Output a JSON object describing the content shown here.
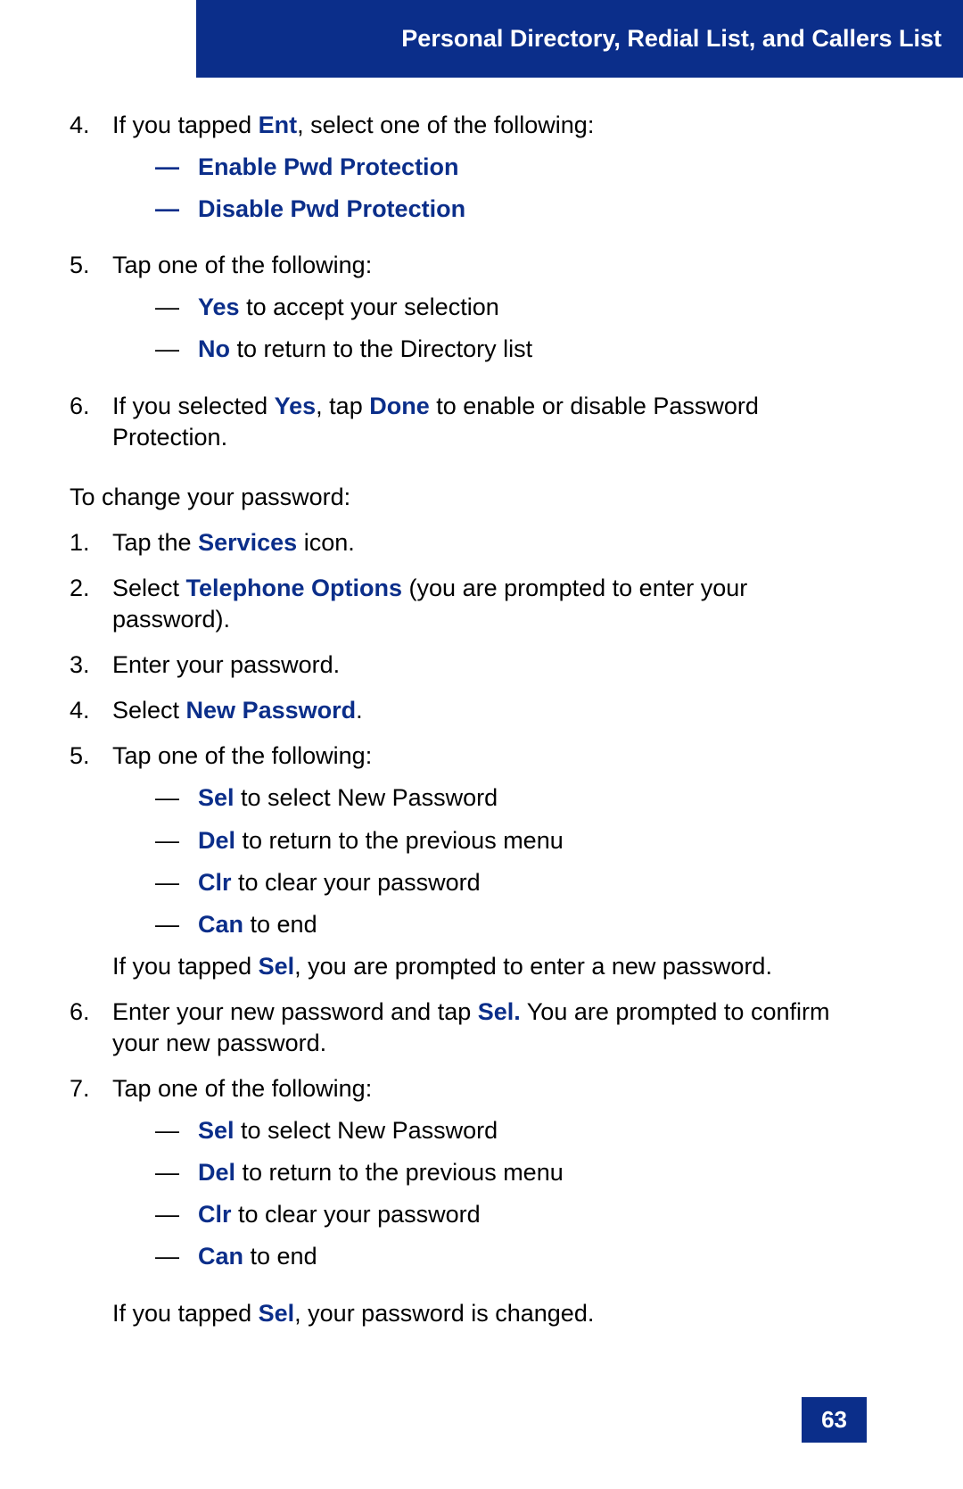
{
  "header": "Personal Directory, Redial List, and Callers List",
  "list1": {
    "item4": {
      "num": "4.",
      "pre": "If you tapped ",
      "ent": "Ent",
      "post": ", select one of the following:",
      "opt1_dash": "—",
      "opt1": "Enable Pwd Protection",
      "opt2_dash": "—",
      "opt2": "Disable Pwd Protection"
    },
    "item5": {
      "num": "5.",
      "text": "Tap one of the following:",
      "opt1_dash": "—",
      "opt1_key": "Yes",
      "opt1_rest": " to accept your selection",
      "opt2_dash": "—",
      "opt2_key": "No",
      "opt2_rest": " to return to the Directory list"
    },
    "item6": {
      "num": "6.",
      "p1": "If you selected ",
      "yes": "Yes",
      "p2": ", tap ",
      "done": "Done",
      "p3": " to enable or disable Password Protection."
    }
  },
  "para1": "To change your password:",
  "list2": {
    "item1": {
      "num": "1.",
      "p1": "Tap the ",
      "key": "Services",
      "p2": " icon."
    },
    "item2": {
      "num": "2.",
      "p1": "Select ",
      "key": "Telephone Options",
      "p2": " (you are prompted to enter your password)."
    },
    "item3": {
      "num": "3.",
      "text": "Enter your password."
    },
    "item4": {
      "num": "4.",
      "p1": "Select ",
      "key": "New Password",
      "p2": "."
    },
    "item5": {
      "num": "5.",
      "text": "Tap one of the following:",
      "o1d": "—",
      "o1k": "Sel",
      "o1r": " to select New Password",
      "o2d": "—",
      "o2k": "Del",
      "o2r": " to return to the previous menu",
      "o3d": "—",
      "o3k": "Clr",
      "o3r": " to clear your password",
      "o4d": "—",
      "o4k": "Can",
      "o4r": " to end",
      "trail_p1": "If you tapped ",
      "trail_key": "Sel",
      "trail_p2": ", you are prompted to enter a new password."
    },
    "item6": {
      "num": "6.",
      "p1": "Enter your new password and tap ",
      "key": "Sel.",
      "p2": " You are prompted to confirm your new password."
    },
    "item7": {
      "num": "7.",
      "text": "Tap one of the following:",
      "o1d": "—",
      "o1k": "Sel",
      "o1r": " to select New Password",
      "o2d": "—",
      "o2k": "Del",
      "o2r": " to return to the previous menu",
      "o3d": "—",
      "o3k": "Clr",
      "o3r": " to clear your password",
      "o4d": "—",
      "o4k": "Can",
      "o4r": " to end",
      "trail_p1": "If you tapped ",
      "trail_key": "Sel",
      "trail_p2": ", your password is changed."
    }
  },
  "page_number": "63"
}
